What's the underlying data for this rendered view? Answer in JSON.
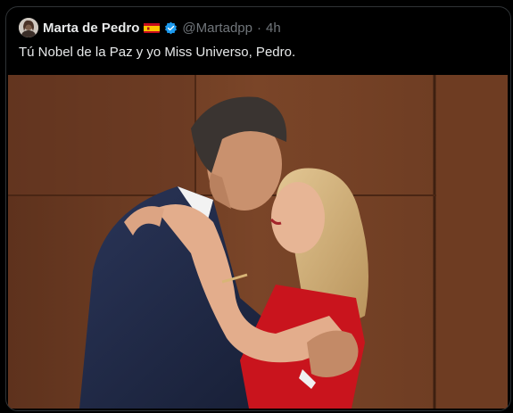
{
  "tweet": {
    "author": {
      "display_name": "Marta de Pedro",
      "flag_icon": "spain-flag-icon",
      "verified_icon": "verified-badge-icon",
      "handle": "@Martadpp"
    },
    "separator": "·",
    "timestamp": "4h",
    "text": "Tú Nobel de la Paz y yo Miss Universo, Pedro.",
    "colors": {
      "background": "#000000",
      "primary_text": "#e7e9ea",
      "secondary_text": "#71767b",
      "verified": "#1d9bf0",
      "border": "#2f3336"
    }
  }
}
